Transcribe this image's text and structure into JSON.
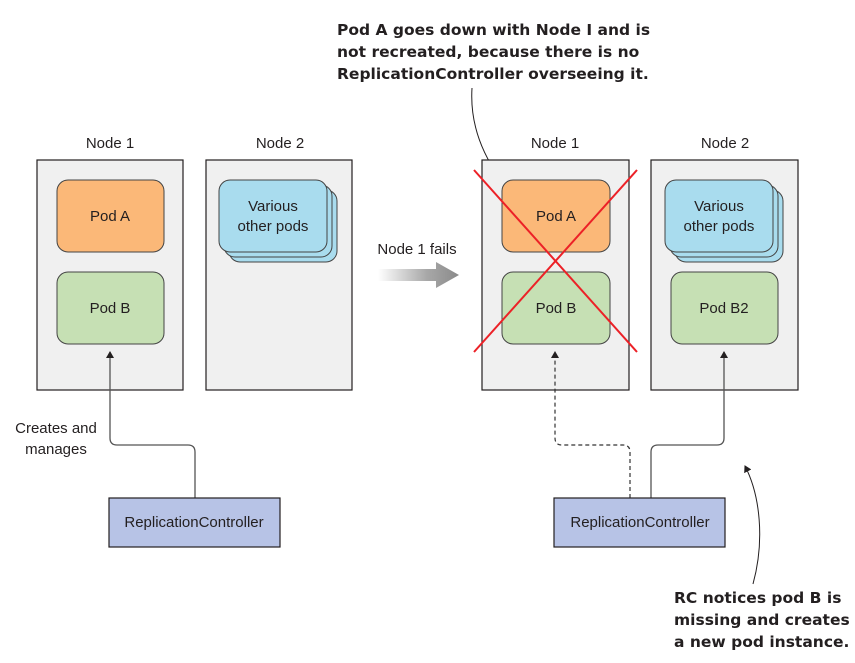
{
  "before": {
    "node1": {
      "label": "Node 1",
      "pods": [
        "Pod A",
        "Pod B"
      ]
    },
    "node2": {
      "label": "Node 2",
      "pods_line1": "Various",
      "pods_line2": "other pods"
    },
    "edge_label_line1": "Creates and",
    "edge_label_line2": "manages",
    "controller": "ReplicationController"
  },
  "transition": {
    "label": "Node 1 fails"
  },
  "after": {
    "node1": {
      "label": "Node 1",
      "pods": [
        "Pod A",
        "Pod B"
      ],
      "status": "failed"
    },
    "node2": {
      "label": "Node 2",
      "pods_line1": "Various",
      "pods_line2": "other pods",
      "new_pod": "Pod B2"
    },
    "controller": "ReplicationController"
  },
  "annotations": {
    "top": [
      "Pod A goes down with Node I and is",
      "not recreated, because there is no",
      "ReplicationController overseeing it."
    ],
    "bottom": [
      "RC notices pod B is",
      "missing and creates",
      "a new pod instance."
    ]
  },
  "colors": {
    "pod_a": "#fbb878",
    "pod_b": "#c6e0b4",
    "other_pods": "#a9dcee",
    "controller": "#b7c3e6",
    "node_bg": "#f0f0f0",
    "failure_x": "#ec2127"
  }
}
